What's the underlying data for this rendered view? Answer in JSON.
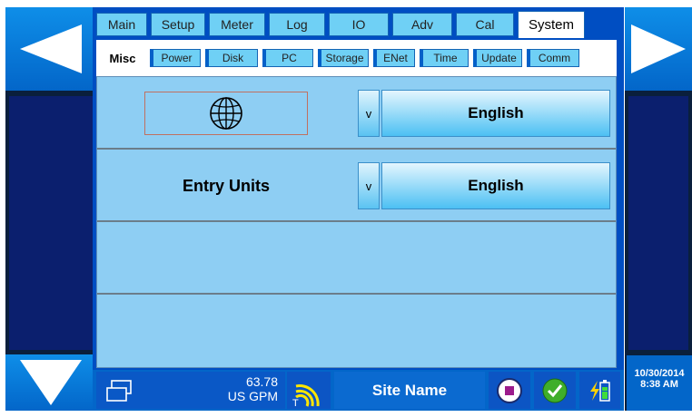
{
  "tabs": [
    "Main",
    "Setup",
    "Meter",
    "Log",
    "IO",
    "Adv",
    "Cal",
    "System"
  ],
  "active_tab": "System",
  "subtabs": [
    "Misc",
    "Power",
    "Disk",
    "PC",
    "Storage",
    "ENet",
    "Time",
    "Update",
    "Comm"
  ],
  "active_subtab": "Misc",
  "settings": {
    "language": {
      "icon": "globe-icon",
      "toggle": "v",
      "value": "English"
    },
    "entry_units": {
      "label": "Entry Units",
      "toggle": "v",
      "value": "English"
    }
  },
  "statusbar": {
    "flow_value": "63.78",
    "flow_unit": "US GPM",
    "signal_label": "T",
    "site_name": "Site Name",
    "date": "10/30/2014",
    "time": "8:38 AM"
  },
  "colors": {
    "accent_blue": "#0366c9",
    "panel_blue": "#8ecef3",
    "tab_cyan": "#6fd0f5"
  }
}
